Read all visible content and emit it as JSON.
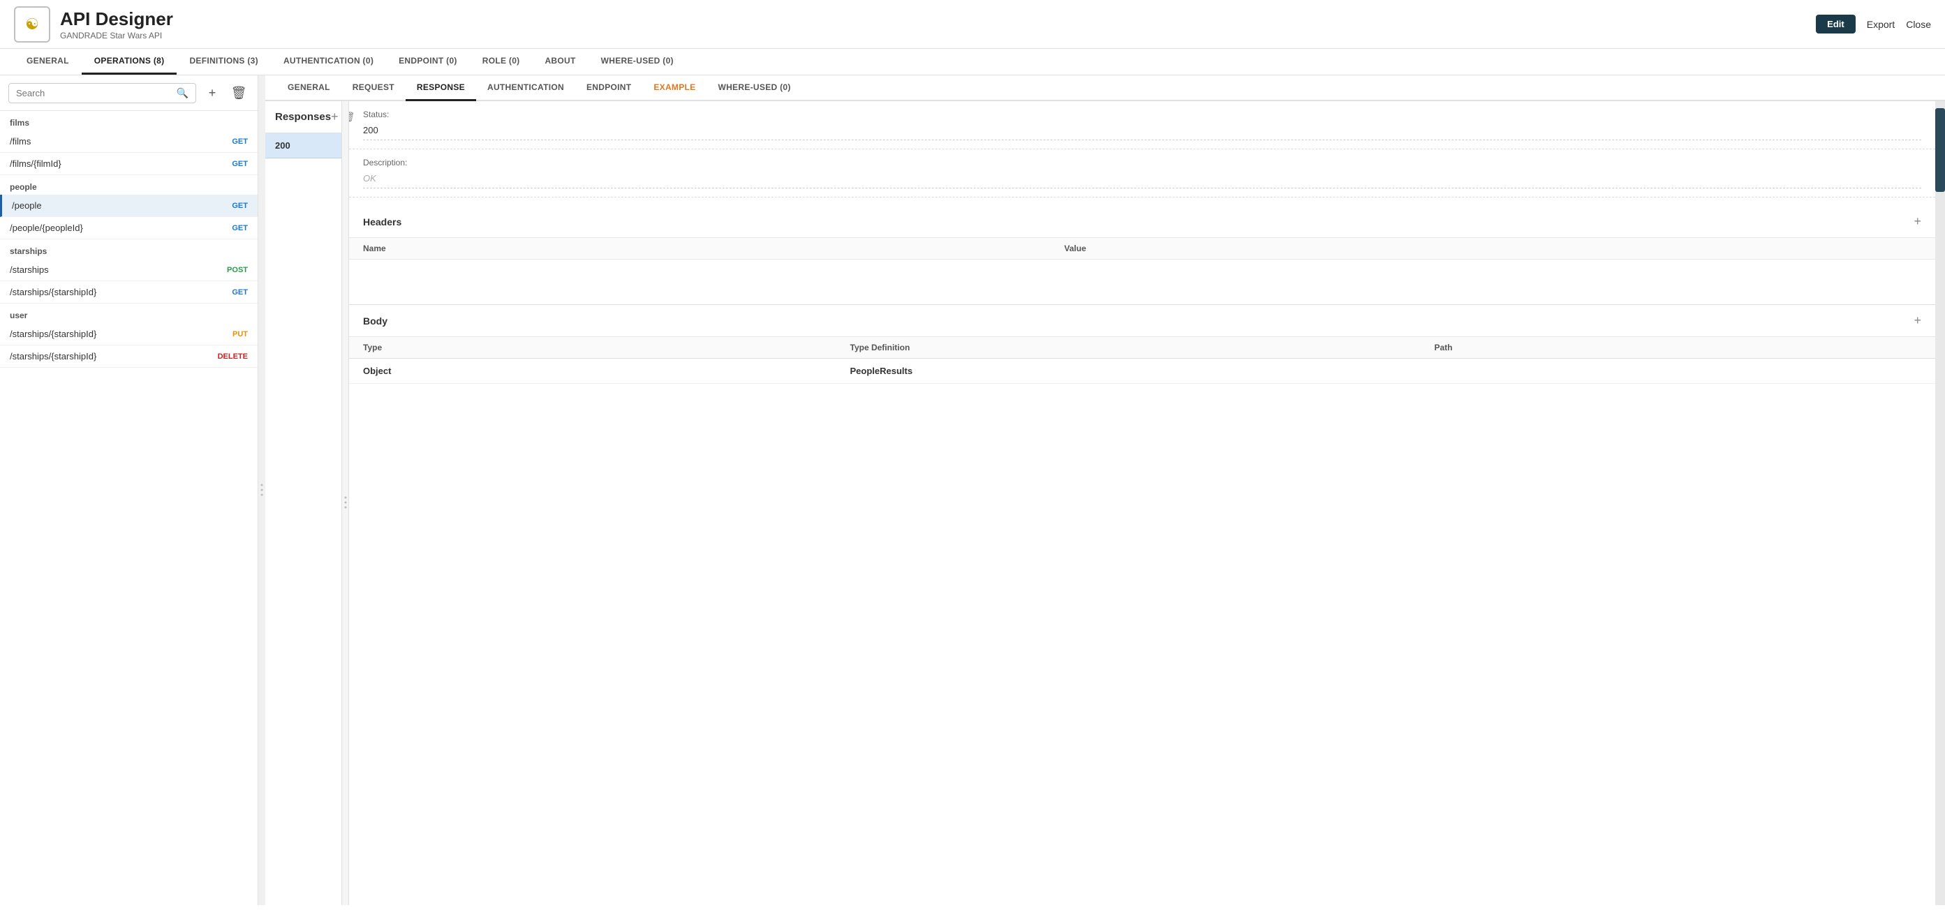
{
  "header": {
    "logo_icon": "☯",
    "title": "API Designer",
    "subtitle": "GANDRADE Star Wars API",
    "btn_edit": "Edit",
    "btn_export": "Export",
    "btn_close": "Close"
  },
  "top_nav": {
    "tabs": [
      {
        "id": "general",
        "label": "GENERAL",
        "active": false
      },
      {
        "id": "operations",
        "label": "OPERATIONS (8)",
        "active": true
      },
      {
        "id": "definitions",
        "label": "DEFINITIONS (3)",
        "active": false
      },
      {
        "id": "authentication",
        "label": "AUTHENTICATION (0)",
        "active": false
      },
      {
        "id": "endpoint",
        "label": "ENDPOINT (0)",
        "active": false
      },
      {
        "id": "role",
        "label": "ROLE (0)",
        "active": false
      },
      {
        "id": "about",
        "label": "ABOUT",
        "active": false
      },
      {
        "id": "where_used",
        "label": "WHERE-USED (0)",
        "active": false
      }
    ]
  },
  "sidebar": {
    "search_placeholder": "Search",
    "groups": [
      {
        "label": "films",
        "items": [
          {
            "path": "/films",
            "method": "GET",
            "method_class": "method-get"
          },
          {
            "path": "/films/{filmId}",
            "method": "GET",
            "method_class": "method-get"
          }
        ]
      },
      {
        "label": "people",
        "items": [
          {
            "path": "/people",
            "method": "GET",
            "method_class": "method-get",
            "active": true
          },
          {
            "path": "/people/{peopleId}",
            "method": "GET",
            "method_class": "method-get"
          }
        ]
      },
      {
        "label": "starships",
        "items": [
          {
            "path": "/starships",
            "method": "POST",
            "method_class": "method-post"
          },
          {
            "path": "/starships/{starshipId}",
            "method": "GET",
            "method_class": "method-get"
          }
        ]
      },
      {
        "label": "user",
        "items": [
          {
            "path": "/starships/{starshipId}",
            "method": "PUT",
            "method_class": "method-put"
          },
          {
            "path": "/starships/{starshipId}",
            "method": "DELETE",
            "method_class": "method-delete"
          }
        ]
      }
    ]
  },
  "sub_tabs": [
    {
      "id": "general",
      "label": "GENERAL",
      "active": false
    },
    {
      "id": "request",
      "label": "REQUEST",
      "active": false
    },
    {
      "id": "response",
      "label": "RESPONSE",
      "active": true
    },
    {
      "id": "authentication",
      "label": "AUTHENTICATION",
      "active": false
    },
    {
      "id": "endpoint",
      "label": "ENDPOINT",
      "active": false
    },
    {
      "id": "example",
      "label": "EXAMPLE",
      "active": false,
      "highlight": true
    },
    {
      "id": "where_used",
      "label": "WHERE-USED (0)",
      "active": false
    }
  ],
  "responses": {
    "title": "Responses",
    "codes": [
      "200"
    ],
    "selected_code": "200",
    "status_label": "Status:",
    "status_value": "200",
    "description_label": "Description:",
    "description_placeholder": "OK",
    "headers": {
      "title": "Headers",
      "col_name": "Name",
      "col_value": "Value",
      "rows": []
    },
    "body": {
      "title": "Body",
      "col_type": "Type",
      "col_typedef": "Type Definition",
      "col_path": "Path",
      "rows": [
        {
          "type": "Object",
          "typedef": "PeopleResults",
          "path": ""
        }
      ]
    }
  }
}
